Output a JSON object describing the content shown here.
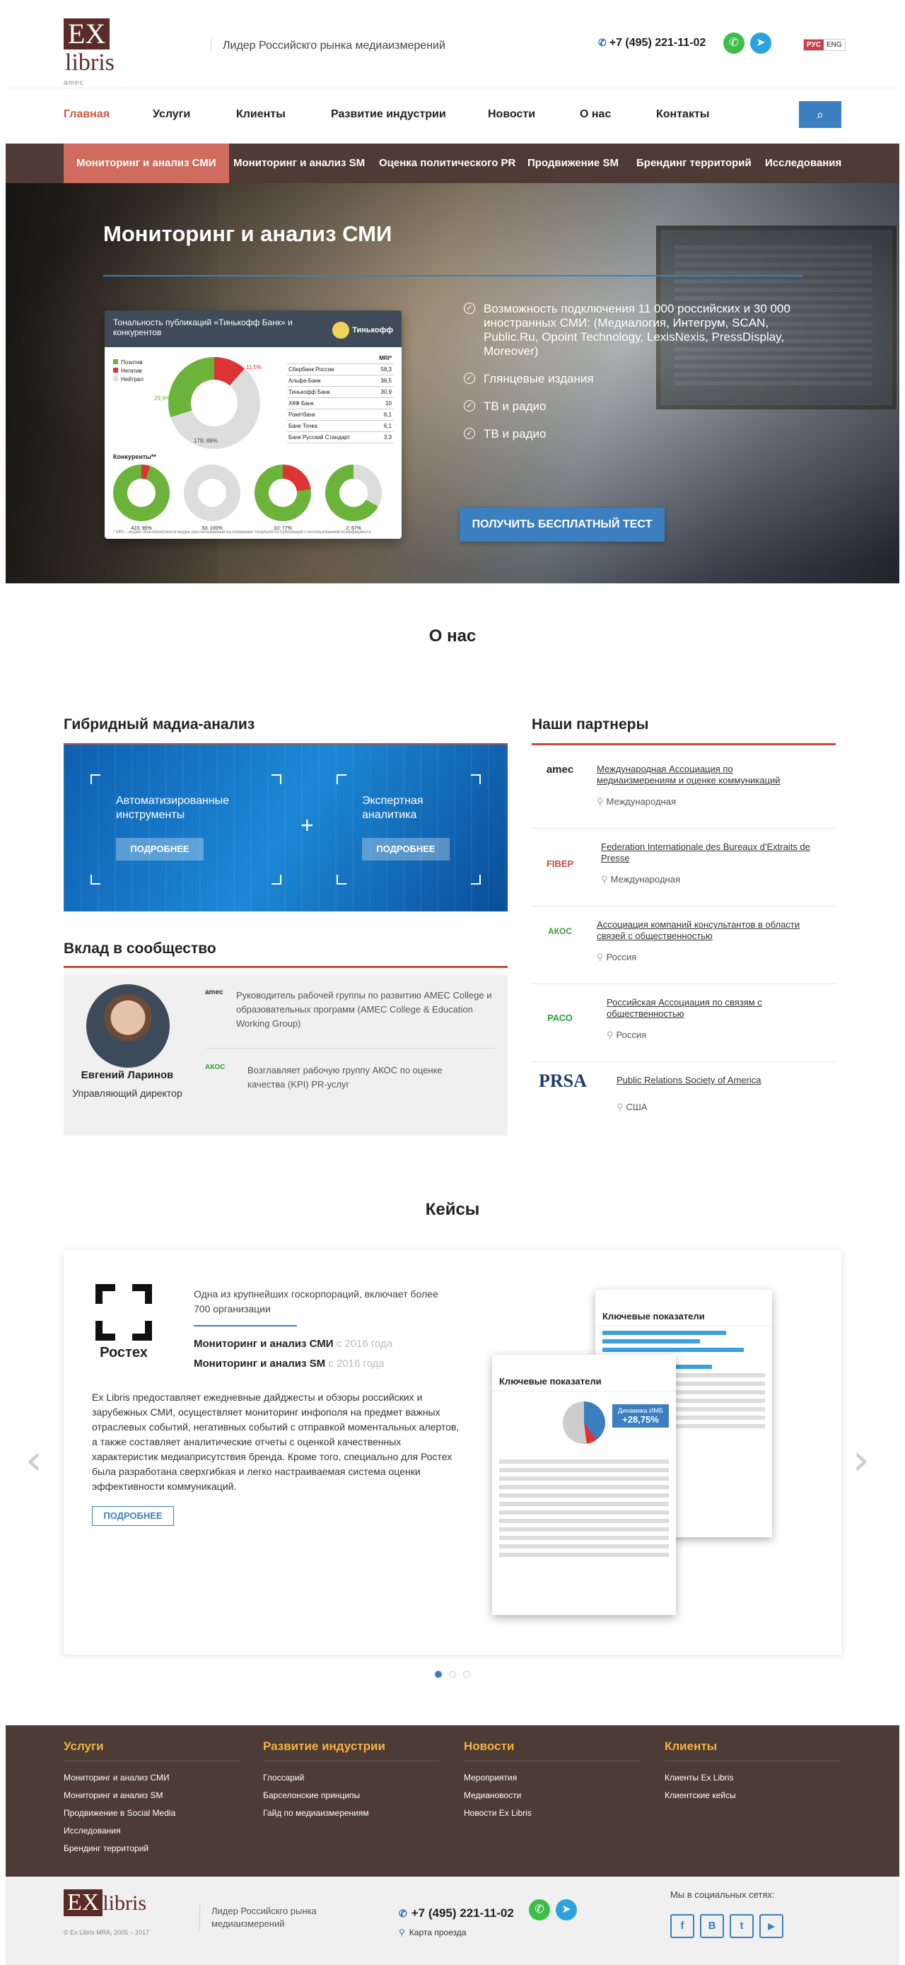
{
  "header": {
    "logo_ex": "EX",
    "logo_libris": "libris",
    "logo_partners": "amec",
    "tagline": "Лидер Российскго рынка медиаизмерений",
    "phone": "+7 (495) 221-11-02",
    "lang_ru": "РУС",
    "lang_en": "ENG"
  },
  "nav": {
    "items": [
      "Главная",
      "Услуги",
      "Клиенты",
      "Развитие индустрии",
      "Новости",
      "О нас",
      "Контакты"
    ]
  },
  "subnav": {
    "items": [
      "Мониторинг и анализ СМИ",
      "Мониторинг и анализ SM",
      "Оценка политического PR",
      "Продвижение SM",
      "Брендинг территорий",
      "Исследования"
    ]
  },
  "hero": {
    "title": "Мониторинг и анализ СМИ",
    "bullets": [
      "Возможность подключения 11 000 российских и 30 000 иностранных СМИ: (Медиалогия, Интегрум, SCAN, Public.Ru, Opoint Technology, LexisNexis, PressDisplay, Moreover)",
      "Глянцевые издания",
      "ТВ и радио",
      "ТВ и радио"
    ],
    "cta": "ПОЛУЧИТЬ БЕСПЛАТНЫЙ ТЕСТ",
    "report": {
      "title": "Тональность публикаций «Тинькофф Банк» и конкурентов",
      "bank": "Тинькофф",
      "legend": [
        "Позитив",
        "Негатив",
        "Нейтрал"
      ],
      "pie_labels": [
        "11,5%",
        "29,9%",
        "179; 86%"
      ],
      "table_header": "MRI*",
      "rows": [
        {
          "name": "Сбербанк России",
          "value": "58,3"
        },
        {
          "name": "Альфа-Банк",
          "value": "36,5"
        },
        {
          "name": "Тинькофф Банк",
          "value": "30,9"
        },
        {
          "name": "ХКФ Банк",
          "value": "10"
        },
        {
          "name": "Рокетбанк",
          "value": "6,1"
        },
        {
          "name": "Банк Точка",
          "value": "6,1"
        },
        {
          "name": "Банк Русский Стандарт",
          "value": "3,3"
        }
      ],
      "competitors_label": "Конкуренты**",
      "competitors": [
        "423; 95%",
        "33; 100%",
        "10; 77%",
        "2; 67%"
      ],
      "footnote": "* MRI – индекс благоприятности медиа расcчитываемый на основании тональности публикаций с использованием коэффициента"
    }
  },
  "about": {
    "title": "О нас",
    "hybrid_title": "Гибридный мадиа-анализ",
    "box1": "Автоматизированные инструменты",
    "box2": "Экспертная аналитика",
    "more": "ПОДРОБНЕЕ",
    "contrib_title": "Вклад в сообщество",
    "person_name": "Евгений Ларинов",
    "person_role": "Управляющий директор",
    "contrib_items": [
      {
        "logo": "amec",
        "text": "Руководитель рабочей группы по развитию AMEC College и образовательных программ (AMEC College & Education Working Group)"
      },
      {
        "logo": "АКОС",
        "text": "Возглавляет рабочую группу АКОС по оценке качества (KPI) PR-услуг"
      }
    ],
    "partners_title": "Наши партнеры",
    "partners": [
      {
        "logo": "amec",
        "name": "Международная Ассоциация по медиаизмерениям и оценке коммуникаций",
        "loc": "Международная"
      },
      {
        "logo": "FIBEP",
        "name": "Federation Internationale des Bureaux d'Extraits de Presse",
        "loc": "Международная"
      },
      {
        "logo": "АКОС",
        "name": "Ассоциация компаний консультантов в области связей с общественностью",
        "loc": "Россия"
      },
      {
        "logo": "РАСО",
        "name": "Российская Ассоциация по связям с общественностью",
        "loc": "Россия"
      },
      {
        "logo": "PRSA",
        "name": "Public Relations Society of America",
        "loc": "США"
      }
    ]
  },
  "cases": {
    "title": "Кейсы",
    "client": "Ростех",
    "client_desc": "Одна из крупнейших госкорпораций, включает более 700 организации",
    "services": [
      {
        "name": "Мониторинг и анализ СМИ",
        "since": "с 2016 года"
      },
      {
        "name": "Мониторинг и анализ SM",
        "since": "с 2016 года"
      }
    ],
    "body": "Ex Libris предоставляет ежедневные дайджесты и обзоры российских и зарубежных СМИ, осуществляет мониторинг инфополя на предмет важных отраслевых событий, негативных событий с отправкой моментальных алертов, а также составляет аналитические отчеты с оценкой качественных характеристик медиаприсутствия бренда. Кроме того, специально для Ростех была разработана сверхгибкая и легко настраиваемая система оценки эффективности коммуникаций.",
    "more": "ПОДРОБНЕЕ",
    "doc_title": "Ключевые показатели",
    "doc_value": "+28,75%",
    "doc_value_label": "Динамика ИМБ"
  },
  "footer": {
    "cols": [
      {
        "title": "Услуги",
        "links": [
          "Мониторинг и анализ СМИ",
          "Мониторинг и анализ SM",
          "Продвижение в Social Media",
          "Исследования",
          "Брендинг территорий"
        ]
      },
      {
        "title": "Развитие индустрии",
        "links": [
          "Глоссарий",
          "Барселонские принципы",
          "Гайд по медиаизмерениям"
        ]
      },
      {
        "title": "Новости",
        "links": [
          "Мероприятия",
          "Медиановости",
          "Новости Ex Libris"
        ]
      },
      {
        "title": "Клиенты",
        "links": [
          "Клиенты Ex Libris",
          "Клиентские кейсы"
        ]
      }
    ],
    "copyright": "© Ex Libris MRA, 2005 – 2017",
    "tagline": "Лидер Российскго рынка медиаизмерений",
    "phone": "+7 (495) 221-11-02",
    "map": "Карта проезда",
    "social_label": "Мы в социальных сетях:",
    "social": [
      "f",
      "В",
      "t",
      "▶"
    ]
  },
  "colors": {
    "accent": "#3b7fc0",
    "brand": "#5b2b28",
    "red": "#c64b3d",
    "footer": "#4d3b36",
    "footer_heading": "#f4b342"
  },
  "icons": [
    "search-icon",
    "phone-icon",
    "whatsapp-icon",
    "telegram-icon",
    "check-icon",
    "location-icon",
    "plus-icon",
    "chevron-left-icon",
    "chevron-right-icon"
  ]
}
